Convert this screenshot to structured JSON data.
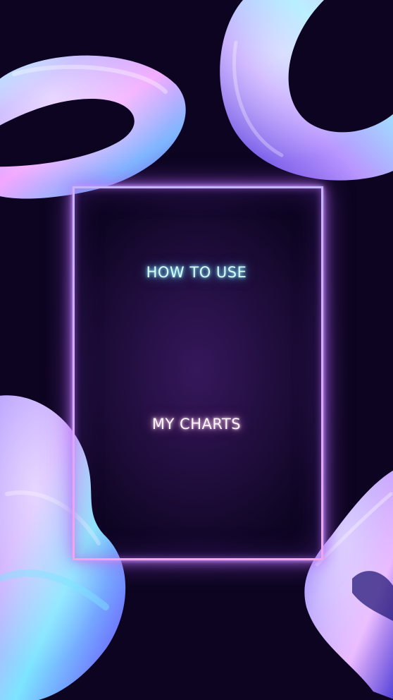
{
  "heading": {
    "line1": "HOW TO USE",
    "line2": "MY CHARTS"
  },
  "colors": {
    "background": "#0c0420",
    "frame": "#d6b6ff",
    "title_line1": "#d8fbff",
    "title_line2": "#fff7fb"
  },
  "decorations": [
    "holographic-torus-icon",
    "holographic-ribbon-icon",
    "holographic-blob-icon",
    "holographic-wave-icon"
  ]
}
